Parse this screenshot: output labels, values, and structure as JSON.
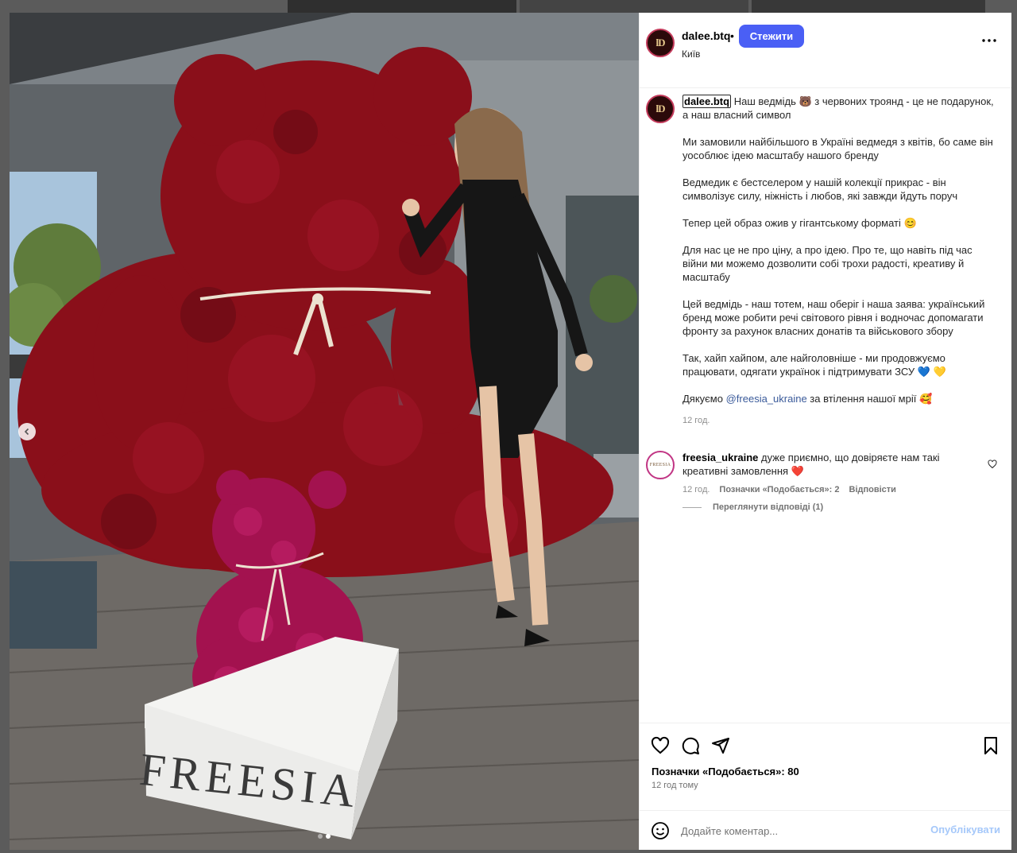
{
  "post": {
    "username": "dalee.btq",
    "avatar_text": "lD",
    "follow_label": "Стежити",
    "location": "Київ",
    "more_icon": "more-icon"
  },
  "photo": {
    "box_text": "FREESIA",
    "carousel_total": 2,
    "carousel_active": 2
  },
  "caption": {
    "username": "dalee.btq",
    "paragraphs": [
      "Наш ведмідь 🐻 з червоних троянд - це не подарунок, а наш власний символ",
      "Ми замовили найбільшого в Україні ведмедя з квітів, бо саме він уособлює ідею масштабу нашого бренду",
      "Ведмедик є бестселером у нашій колекції прикрас - він символізує силу, ніжність і любов, які завжди йдуть поруч",
      "Тепер цей образ ожив у гігантському форматі 😊",
      "Для нас це не про ціну, а про ідею. Про те, що навіть під час війни ми можемо дозволити собі трохи радості, креативу й масштабу",
      "Цей ведмідь - наш тотем, наш оберіг і наша заява: український бренд може робити речі світового рівня і водночас допомагати фронту за рахунок власних донатів та військового збору",
      "Так, хайп хайпом, але найголовніше - ми продовжуємо працювати, одягати українок і підтримувати ЗСУ 💙 💛"
    ],
    "thanks_prefix": "Дякуємо ",
    "thanks_mention": "@freesia_ukraine",
    "thanks_suffix": " за втілення нашої мрії 🥰",
    "time": "12 год."
  },
  "reply": {
    "username": "freesia_ukraine",
    "avatar_text": "FREESIA",
    "text": "дуже приємно, що довіряєте нам такі креативні замовлення ❤️",
    "time": "12 год.",
    "likes": "Позначки «Подобається»: 2",
    "reply_label": "Відповісти",
    "view_replies": "Переглянути відповіді (1)"
  },
  "actions": {
    "likes": "Позначки «Подобається»: 80",
    "posted": "12 год тому"
  },
  "comment": {
    "placeholder": "Додайте коментар...",
    "publish_label": "Опублікувати"
  },
  "colors": {
    "follow": "#4a5ff5",
    "publish": "#a5c8fa",
    "mention": "#3a5a9a"
  }
}
